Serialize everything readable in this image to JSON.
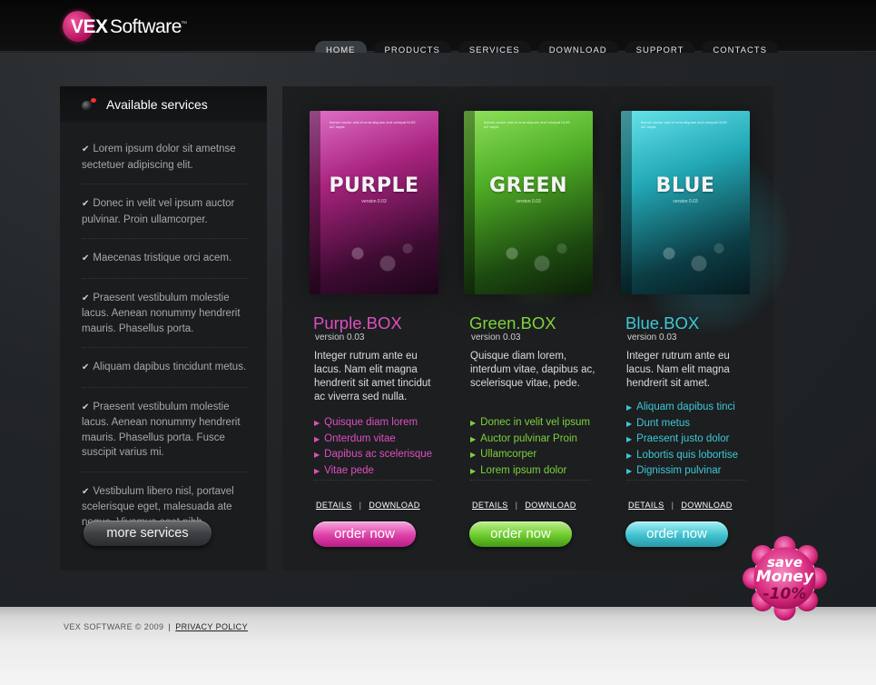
{
  "brand": {
    "mark": "VEX",
    "name": "Software",
    "tm": "™"
  },
  "nav": [
    {
      "label": "HOME",
      "active": true
    },
    {
      "label": "PRODUCTS",
      "active": false
    },
    {
      "label": "SERVICES",
      "active": false
    },
    {
      "label": "DOWNLOAD",
      "active": false
    },
    {
      "label": "SUPPORT",
      "active": false
    },
    {
      "label": "CONTACTS",
      "active": false
    }
  ],
  "sidebar": {
    "title": "Available services",
    "icon": "bomb-icon",
    "items": [
      "Lorem ipsum dolor sit ametnse sectetuer adipiscing elit.",
      "Donec in velit vel ipsum auctor pulvinar. Proin ullamcorper.",
      "Maecenas tristique orci acem.",
      "Praesent vestibulum molestie lacus. Aenean nonummy hendrerit mauris. Phasellus porta.",
      "Aliquam dapibus tincidunt metus.",
      "Praesent vestibulum molestie lacus. Aenean nonummy hendrerit mauris. Phasellus porta. Fusce suscipit varius mi.",
      "Vestibulum libero nisl, portavel scelerisque eget, malesuada ate neque. Vivamus eget nibh."
    ],
    "more_label": "more services"
  },
  "products": [
    {
      "box_title": "PURPLE",
      "name": "Purple.BOX",
      "version": "version 0.03",
      "color": "#e04ec0",
      "description": "Integer rutrum ante eu lacus. Nam elit magna hendrerit sit amet tincidut ac viverra sed nulla.",
      "features": [
        "Quisque diam lorem",
        "Onterdum vitae",
        "Dapibus ac scelerisque",
        "Vitae pede"
      ],
      "details_label": "DETAILS",
      "download_label": "DOWNLOAD",
      "order_label": "order now"
    },
    {
      "box_title": "GREEN",
      "name": "Green.BOX",
      "version": "version 0.03",
      "color": "#7ed23a",
      "description": "Quisque diam lorem, interdum vitae, dapibus ac, scelerisque vitae, pede.",
      "features": [
        "Donec in velit vel ipsum",
        "Auctor pulvinar Proin",
        "Ullamcorper",
        "Lorem ipsum dolor"
      ],
      "details_label": "DETAILS",
      "download_label": "DOWNLOAD",
      "order_label": "order now"
    },
    {
      "box_title": "BLUE",
      "name": "Blue.BOX",
      "version": "version 0.03",
      "color": "#3ec8d8",
      "description": "Integer rutrum ante eu lacus. Nam elit magna hendrerit sit amet.",
      "features": [
        "Aliquam dapibus tinci",
        "Dunt metus",
        "Praesent justo dolor",
        "Lobortis quis lobortise",
        "Dignissim pulvinar"
      ],
      "details_label": "DETAILS",
      "download_label": "DOWNLOAD",
      "order_label": "order now"
    }
  ],
  "badge": {
    "line1": "save",
    "line2": "Money",
    "line3": "-10%"
  },
  "footer": {
    "copyright": "VEX SOFTWARE © 2009",
    "privacy": "PRIVACY POLICY"
  }
}
